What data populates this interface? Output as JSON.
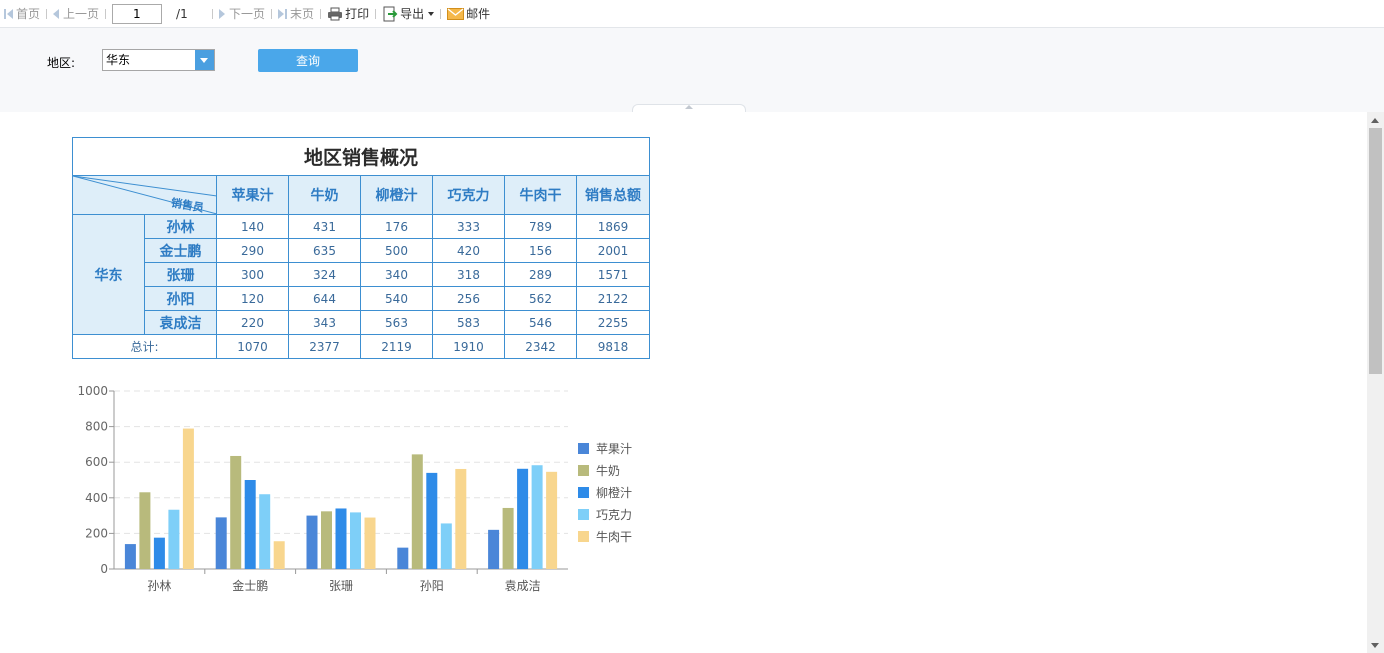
{
  "toolbar": {
    "first": "首页",
    "prev": "上一页",
    "page_current": "1",
    "page_total": "/1",
    "next": "下一页",
    "last": "末页",
    "print": "打印",
    "export": "导出",
    "mail": "邮件"
  },
  "params": {
    "region_label": "地区:",
    "region_value": "华东",
    "query_button": "查询"
  },
  "report": {
    "title": "地区销售概况",
    "diag_label": "销售员",
    "headers": [
      "苹果汁",
      "牛奶",
      "柳橙汁",
      "巧克力",
      "牛肉干",
      "销售总额"
    ],
    "region": "华东",
    "rows": [
      {
        "name": "孙林",
        "values": [
          "140",
          "431",
          "176",
          "333",
          "789",
          "1869"
        ]
      },
      {
        "name": "金士鹏",
        "values": [
          "290",
          "635",
          "500",
          "420",
          "156",
          "2001"
        ]
      },
      {
        "name": "张珊",
        "values": [
          "300",
          "324",
          "340",
          "318",
          "289",
          "1571"
        ]
      },
      {
        "name": "孙阳",
        "values": [
          "120",
          "644",
          "540",
          "256",
          "562",
          "2122"
        ]
      },
      {
        "name": "袁成洁",
        "values": [
          "220",
          "343",
          "563",
          "583",
          "546",
          "2255"
        ]
      }
    ],
    "total_label": "总计:",
    "totals": [
      "1070",
      "2377",
      "2119",
      "1910",
      "2342",
      "9818"
    ]
  },
  "chart_data": {
    "type": "bar",
    "categories": [
      "孙林",
      "金士鹏",
      "张珊",
      "孙阳",
      "袁成洁"
    ],
    "series": [
      {
        "name": "苹果汁",
        "color": "#4a86d8",
        "values": [
          140,
          290,
          300,
          120,
          220
        ]
      },
      {
        "name": "牛奶",
        "color": "#b8ba7c",
        "values": [
          431,
          635,
          324,
          644,
          343
        ]
      },
      {
        "name": "柳橙汁",
        "color": "#2e8be8",
        "values": [
          176,
          500,
          340,
          540,
          563
        ]
      },
      {
        "name": "巧克力",
        "color": "#7ecff8",
        "values": [
          333,
          420,
          318,
          256,
          583
        ]
      },
      {
        "name": "牛肉干",
        "color": "#f8d68e",
        "values": [
          789,
          156,
          289,
          562,
          546
        ]
      }
    ],
    "yticks": [
      "0",
      "200",
      "400",
      "600",
      "800",
      "1000"
    ],
    "ylim": [
      0,
      1000
    ],
    "grid": true,
    "legend_position": "right"
  }
}
